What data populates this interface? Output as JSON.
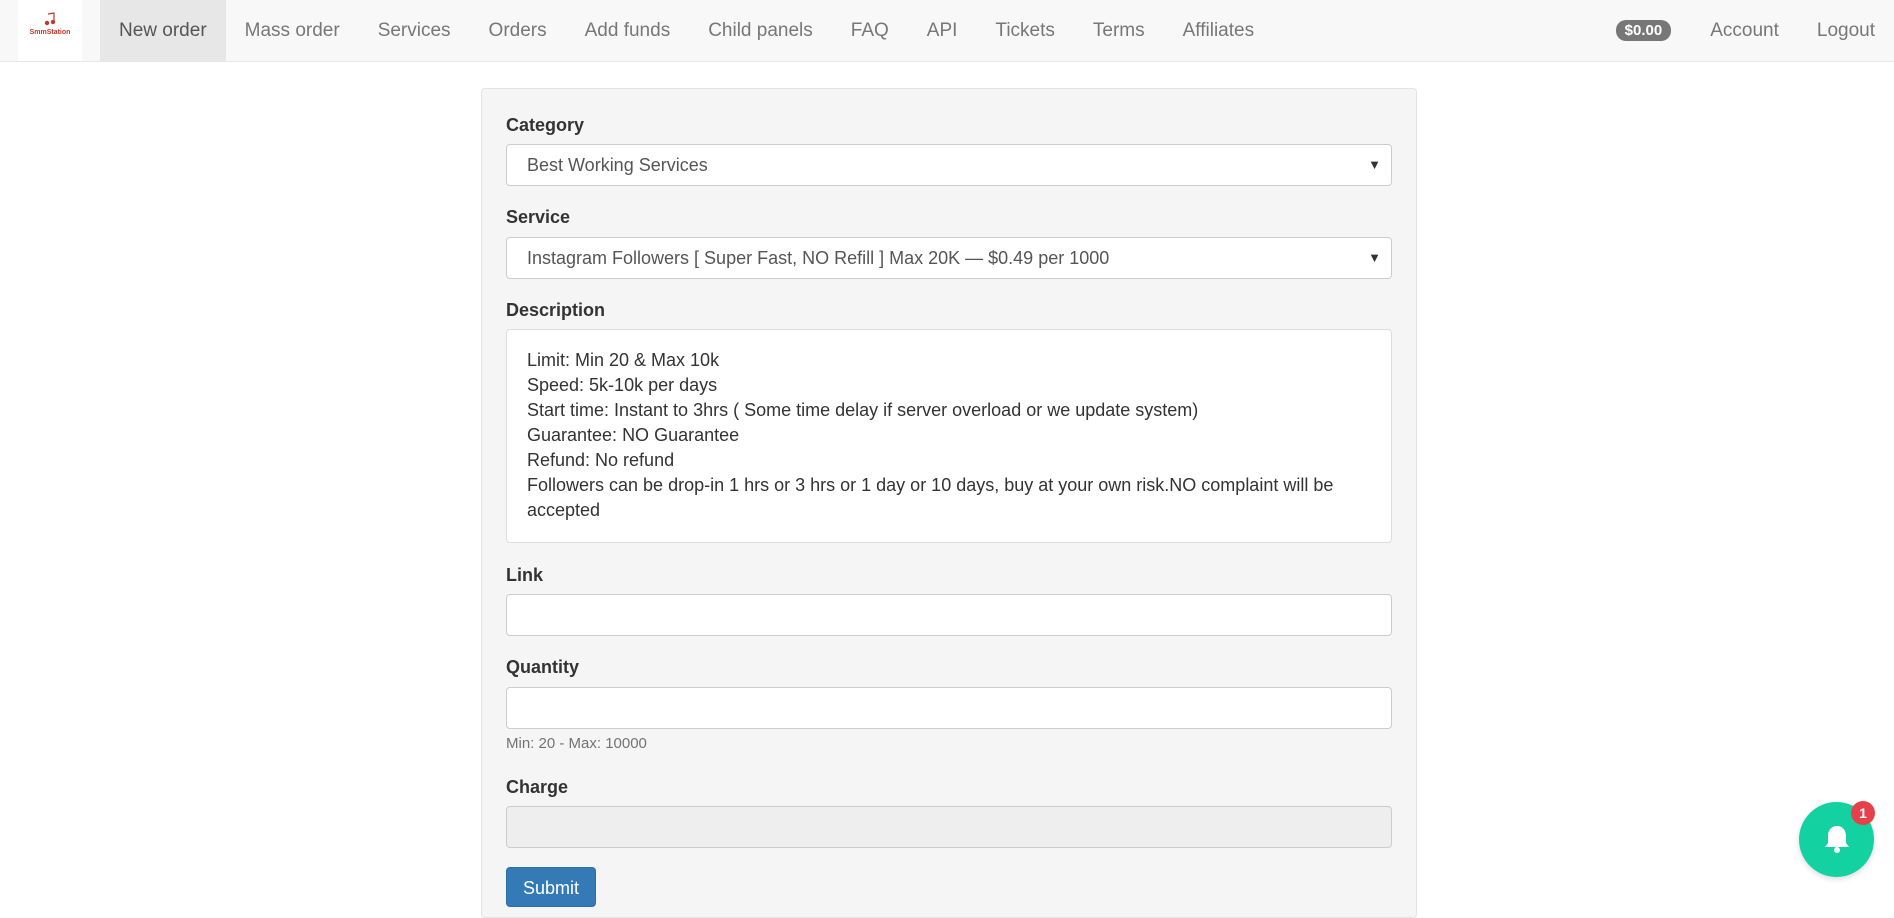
{
  "brand": {
    "logo_text": "SmmStation"
  },
  "nav": {
    "items": [
      {
        "label": "New order",
        "active": true
      },
      {
        "label": "Mass order"
      },
      {
        "label": "Services"
      },
      {
        "label": "Orders"
      },
      {
        "label": "Add funds"
      },
      {
        "label": "Child panels"
      },
      {
        "label": "FAQ"
      },
      {
        "label": "API"
      },
      {
        "label": "Tickets"
      },
      {
        "label": "Terms"
      },
      {
        "label": "Affiliates"
      }
    ],
    "balance": "$0.00",
    "account_label": "Account",
    "logout_label": "Logout"
  },
  "form": {
    "category_label": "Category",
    "category_value": "Best Working Services",
    "service_label": "Service",
    "service_value": "Instagram Followers [ Super Fast, NO Refill ] Max 20K — $0.49 per 1000",
    "description_label": "Description",
    "description_lines": [
      "Limit: Min 20 & Max 10k",
      "Speed: 5k-10k per days",
      "Start time: Instant to 3hrs ( Some time delay if server overload or we update system)",
      "Guarantee: NO Guarantee",
      "Refund: No refund",
      "Followers can be drop-in 1 hrs or 3 hrs or 1 day or 10 days, buy at your own risk.NO complaint will be",
      "accepted"
    ],
    "link_label": "Link",
    "link_value": "",
    "quantity_label": "Quantity",
    "quantity_value": "",
    "quantity_help": "Min: 20 - Max: 10000",
    "charge_label": "Charge",
    "charge_value": "",
    "submit_label": "Submit"
  },
  "notifications": {
    "count": "1",
    "icon": "bell-icon",
    "color": "#13d1a0",
    "badge_color": "#e8404a"
  },
  "colors": {
    "primary": "#337ab7",
    "navbar_bg": "#f8f8f8"
  }
}
